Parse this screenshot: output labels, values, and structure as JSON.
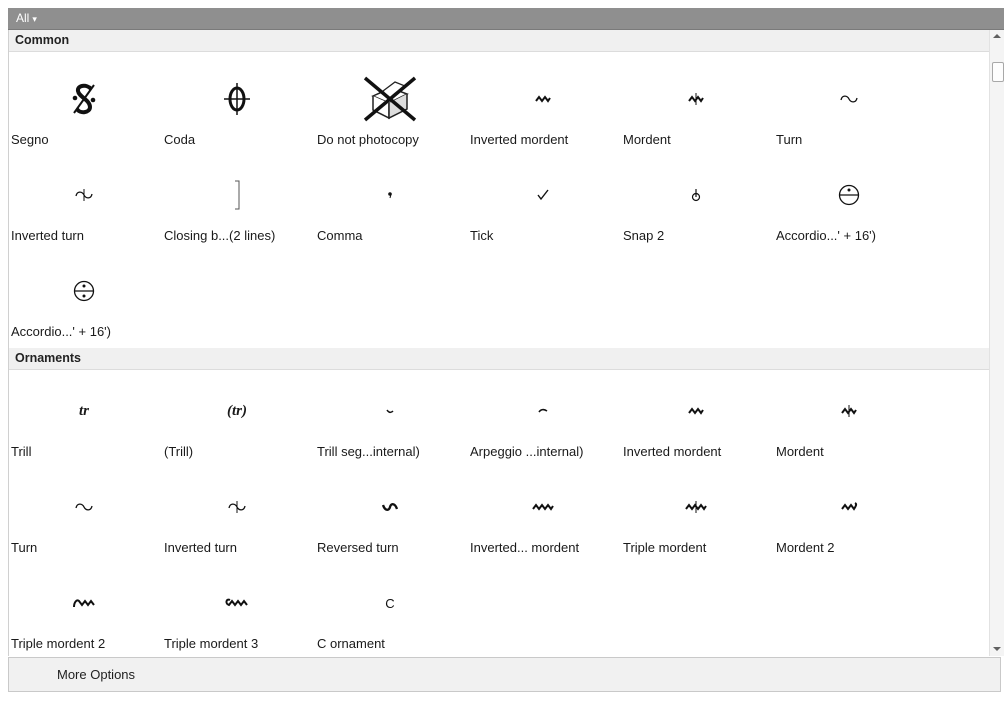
{
  "filter": {
    "label": "All",
    "caret": "▾"
  },
  "sections": {
    "common": {
      "title": "Common",
      "items": [
        {
          "label": "Segno",
          "icon": "segno-icon"
        },
        {
          "label": "Coda",
          "icon": "coda-icon"
        },
        {
          "label": "Do not photocopy",
          "icon": "do-not-photocopy-icon"
        },
        {
          "label": "Inverted mordent",
          "icon": "inverted-mordent-icon"
        },
        {
          "label": "Mordent",
          "icon": "mordent-icon"
        },
        {
          "label": "Turn",
          "icon": "turn-icon"
        },
        {
          "label": "Inverted turn",
          "icon": "inverted-turn-icon"
        },
        {
          "label": "Closing b...(2 lines)",
          "icon": "closing-bracket-icon"
        },
        {
          "label": "Comma",
          "icon": "comma-icon"
        },
        {
          "label": "Tick",
          "icon": "tick-icon"
        },
        {
          "label": "Snap 2",
          "icon": "snap-icon"
        },
        {
          "label": "Accordio...' + 16')",
          "icon": "accordion-register-icon"
        },
        {
          "label": "Accordio...' + 16')",
          "icon": "accordion-register-icon"
        }
      ]
    },
    "ornaments": {
      "title": "Ornaments",
      "items": [
        {
          "label": "Trill",
          "icon": "trill-icon",
          "glyph": "tr"
        },
        {
          "label": "(Trill)",
          "icon": "trill-parenthesized-icon",
          "glyph": "(tr)"
        },
        {
          "label": "Trill seg...internal)",
          "icon": "trill-segment-icon"
        },
        {
          "label": "Arpeggio ...internal)",
          "icon": "arpeggio-segment-icon"
        },
        {
          "label": "Inverted mordent",
          "icon": "inverted-mordent-icon"
        },
        {
          "label": "Mordent",
          "icon": "mordent-icon"
        },
        {
          "label": "Turn",
          "icon": "turn-icon"
        },
        {
          "label": "Inverted turn",
          "icon": "inverted-turn-icon"
        },
        {
          "label": "Reversed turn",
          "icon": "reversed-turn-icon"
        },
        {
          "label": "Inverted... mordent",
          "icon": "inverted-long-mordent-icon"
        },
        {
          "label": "Triple mordent",
          "icon": "triple-mordent-icon"
        },
        {
          "label": "Mordent 2",
          "icon": "mordent-2-icon"
        },
        {
          "label": "Triple mordent 2",
          "icon": "triple-mordent-2-icon"
        },
        {
          "label": "Triple mordent 3",
          "icon": "triple-mordent-3-icon"
        },
        {
          "label": "C ornament",
          "icon": "c-ornament-icon",
          "glyph": "C"
        }
      ]
    }
  },
  "footer": {
    "more_options": "More Options"
  }
}
